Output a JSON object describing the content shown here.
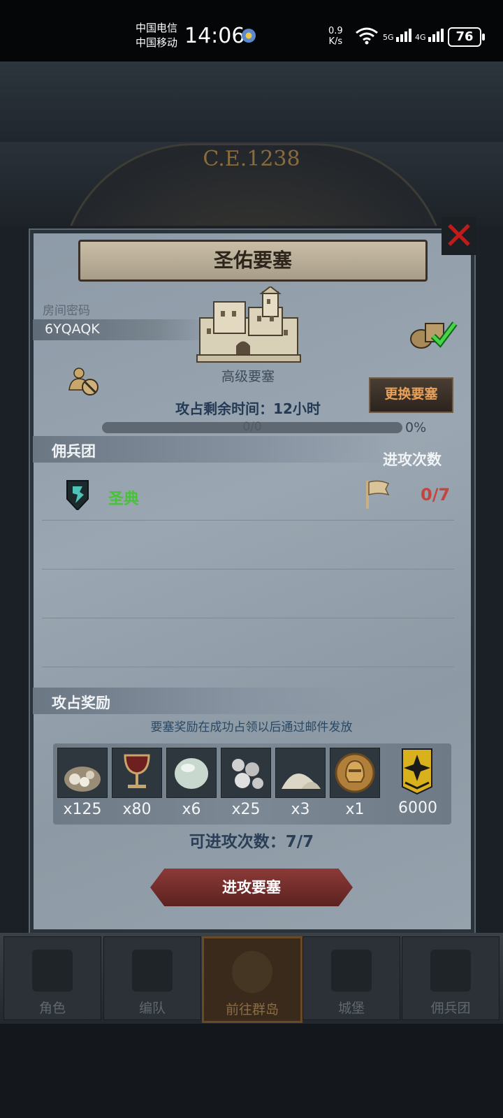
{
  "status_bar": {
    "carrier1": "中国电信",
    "carrier2": "中国移动",
    "time": "14:06",
    "net_speed_value": "0.9",
    "net_speed_unit": "K/s",
    "signal1": "5G",
    "signal2": "4G",
    "battery": "76"
  },
  "background": {
    "era": "C.E.1238"
  },
  "dialog": {
    "title": "圣佑要塞",
    "room_label": "房间密码",
    "room_code": "6YQAQK",
    "fortress_level": "高级要塞",
    "change_button": "更换要塞",
    "remaining_time": "攻占剩余时间：12小时",
    "progress_text": "0/0",
    "progress_percent": "0%",
    "progress_value": 0,
    "mercenary_header": "佣兵团",
    "attack_count_header": "进攻次数",
    "guilds": [
      {
        "name": "圣典",
        "attempts": "0/7"
      }
    ],
    "reward_header": "攻占奖励",
    "reward_note": "要塞奖励在成功占领以后通过邮件发放",
    "rewards": [
      {
        "icon": "ore-sack-icon",
        "qty": "x125"
      },
      {
        "icon": "goblet-icon",
        "qty": "x80"
      },
      {
        "icon": "moonstone-icon",
        "qty": "x6"
      },
      {
        "icon": "silver-pearls-icon",
        "qty": "x25"
      },
      {
        "icon": "salt-pile-icon",
        "qty": "x3"
      },
      {
        "icon": "knight-coin-icon",
        "qty": "x1"
      },
      {
        "icon": "guild-banner-icon",
        "qty": "6000"
      }
    ],
    "attack_available": "可进攻次数：7/7",
    "attack_button": "进攻要塞"
  },
  "bottom_nav": [
    {
      "label": "角色",
      "icon": "knight-icon",
      "active": false
    },
    {
      "label": "编队",
      "icon": "helmet-icon",
      "active": false
    },
    {
      "label": "前往群岛",
      "icon": "compass-icon",
      "active": true
    },
    {
      "label": "城堡",
      "icon": "castle-icon",
      "active": false
    },
    {
      "label": "佣兵团",
      "icon": "ship-icon",
      "active": false
    }
  ],
  "colors": {
    "panel": "#96a2ad",
    "guild_name": "#49c23a",
    "attempts": "#c4453d",
    "change_button_text": "#e8a15a",
    "attack_button": "#8b3a37"
  }
}
